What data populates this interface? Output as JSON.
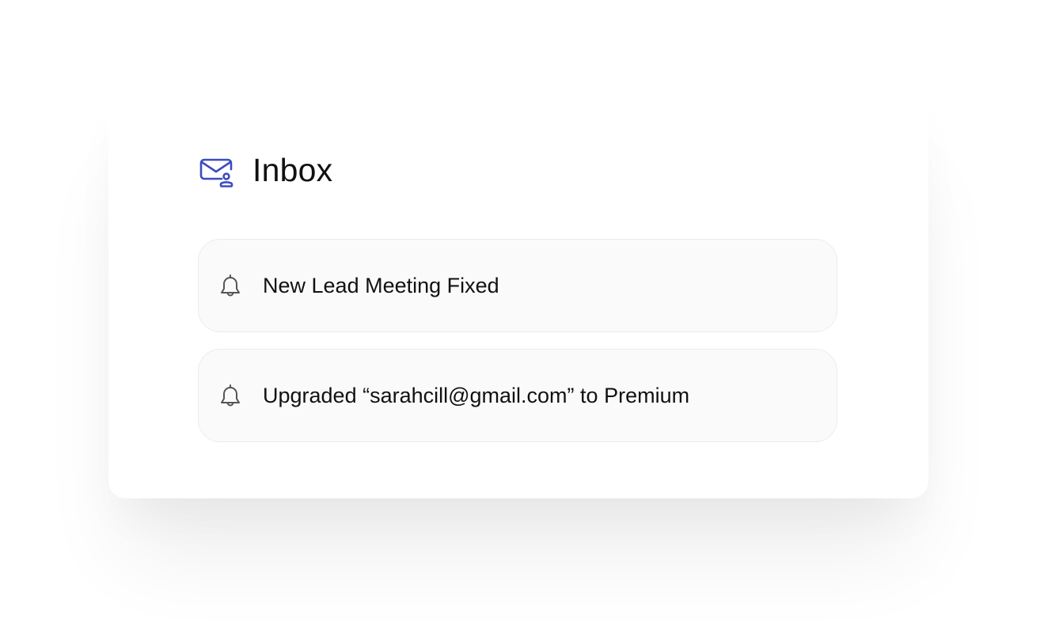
{
  "inbox": {
    "title": "Inbox",
    "icon": "mail-user-icon",
    "accent_color": "#3b4cc0"
  },
  "notifications": [
    {
      "icon": "bell-icon",
      "text": "New Lead Meeting Fixed"
    },
    {
      "icon": "bell-icon",
      "text": "Upgraded “sarahcill@gmail.com” to Premium"
    }
  ]
}
